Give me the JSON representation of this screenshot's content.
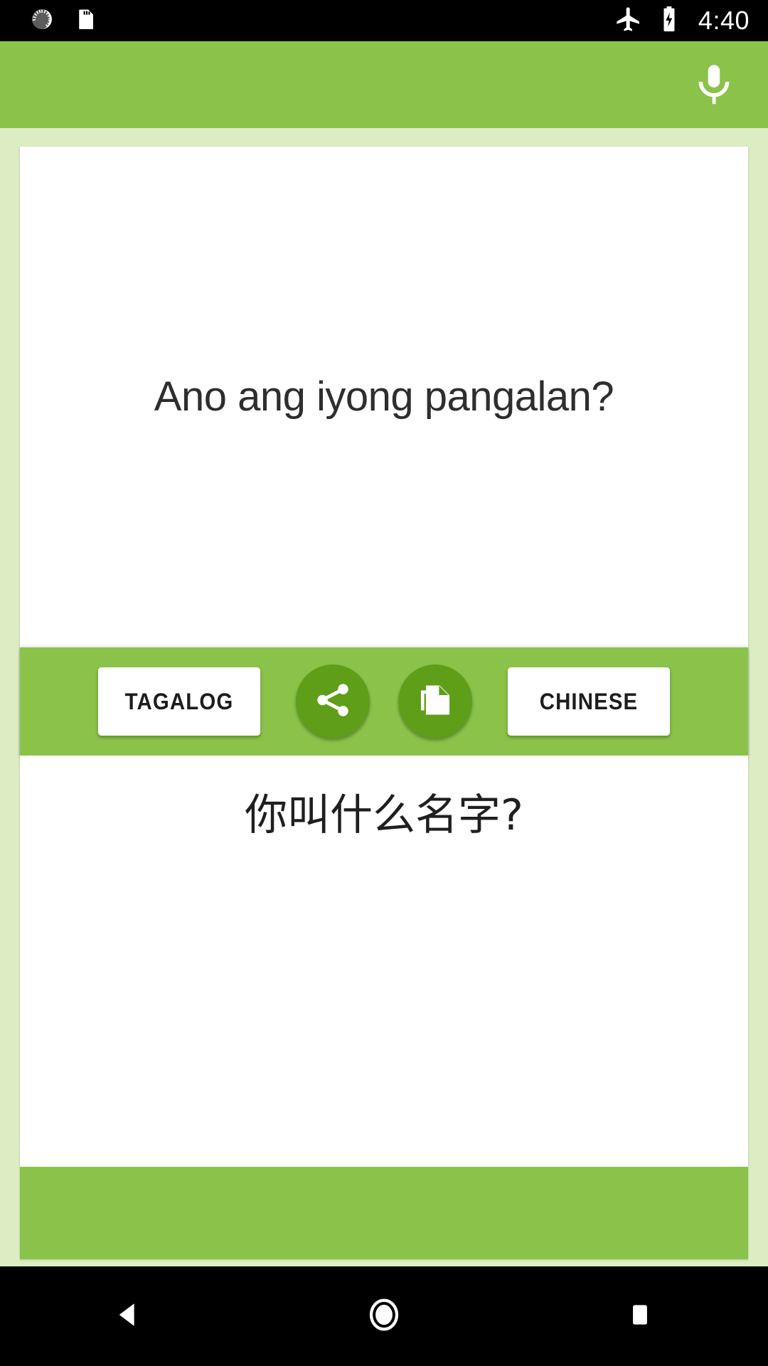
{
  "status_bar": {
    "icons_left": [
      "sync-circle-icon",
      "sd-card-icon"
    ],
    "icons_right": [
      "airplane-mode-icon",
      "battery-charging-icon"
    ],
    "time": "4:40"
  },
  "app_header": {
    "mic_icon": "microphone-icon",
    "background_color": "#8BC34A"
  },
  "translator": {
    "source_text": "Ano ang iyong pangalan?",
    "target_text": "你叫什么名字?",
    "toolbar": {
      "source_language": "TAGALOG",
      "target_language": "CHINESE",
      "share_icon": "share-icon",
      "copy_icon": "copy-icon",
      "background_color": "#8BC34A",
      "circle_button_color": "#5E9E18"
    }
  },
  "banner": {
    "label": "",
    "background_color": "#8BC34A"
  },
  "nav_bar": {
    "back_icon": "back-triangle-icon",
    "home_icon": "home-circle-icon",
    "recents_icon": "recents-square-icon"
  },
  "theme": {
    "page_background": "#DCEDC4",
    "accent": "#8BC34A",
    "accent_dark": "#5E9E18",
    "card_background": "#FFFFFF"
  }
}
